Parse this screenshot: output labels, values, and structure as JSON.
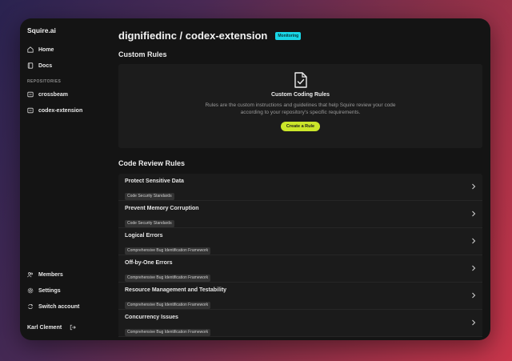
{
  "sidebar": {
    "brand": "Squire.ai",
    "nav": [
      {
        "label": "Home",
        "icon": "home-icon"
      },
      {
        "label": "Docs",
        "icon": "book-icon"
      }
    ],
    "repositories_label": "REPOSITORIES",
    "repositories": [
      {
        "label": "crossbeam",
        "icon": "repo-icon"
      },
      {
        "label": "codex-extension",
        "icon": "repo-icon"
      }
    ],
    "bottom": [
      {
        "label": "Members",
        "icon": "users-icon"
      },
      {
        "label": "Settings",
        "icon": "gear-icon"
      },
      {
        "label": "Switch account",
        "icon": "switch-icon"
      }
    ],
    "user_name": "Karl Clement"
  },
  "header": {
    "title": "dignifiedinc / codex-extension",
    "status": "Monitoring",
    "status_color": "#19d6e6"
  },
  "custom_rules": {
    "heading": "Custom Rules",
    "empty_title": "Custom Coding Rules",
    "empty_desc": "Rules are the custom instructions and guidelines that help Squire review your code according to your repository's specific requirements.",
    "button_label": "Create a Rule",
    "button_color": "#cbe62a"
  },
  "code_review": {
    "heading": "Code Review Rules",
    "rules": [
      {
        "name": "Protect Sensitive Data",
        "tag": "Code Security Standards"
      },
      {
        "name": "Prevent Memory Corruption",
        "tag": "Code Security Standards"
      },
      {
        "name": "Logical Errors",
        "tag": "Comprehensive Bug Identification Framework"
      },
      {
        "name": "Off-by-One Errors",
        "tag": "Comprehensive Bug Identification Framework"
      },
      {
        "name": "Resource Management and Testability",
        "tag": "Comprehensive Bug Identification Framework"
      },
      {
        "name": "Concurrency Issues",
        "tag": "Comprehensive Bug Identification Framework"
      }
    ]
  }
}
